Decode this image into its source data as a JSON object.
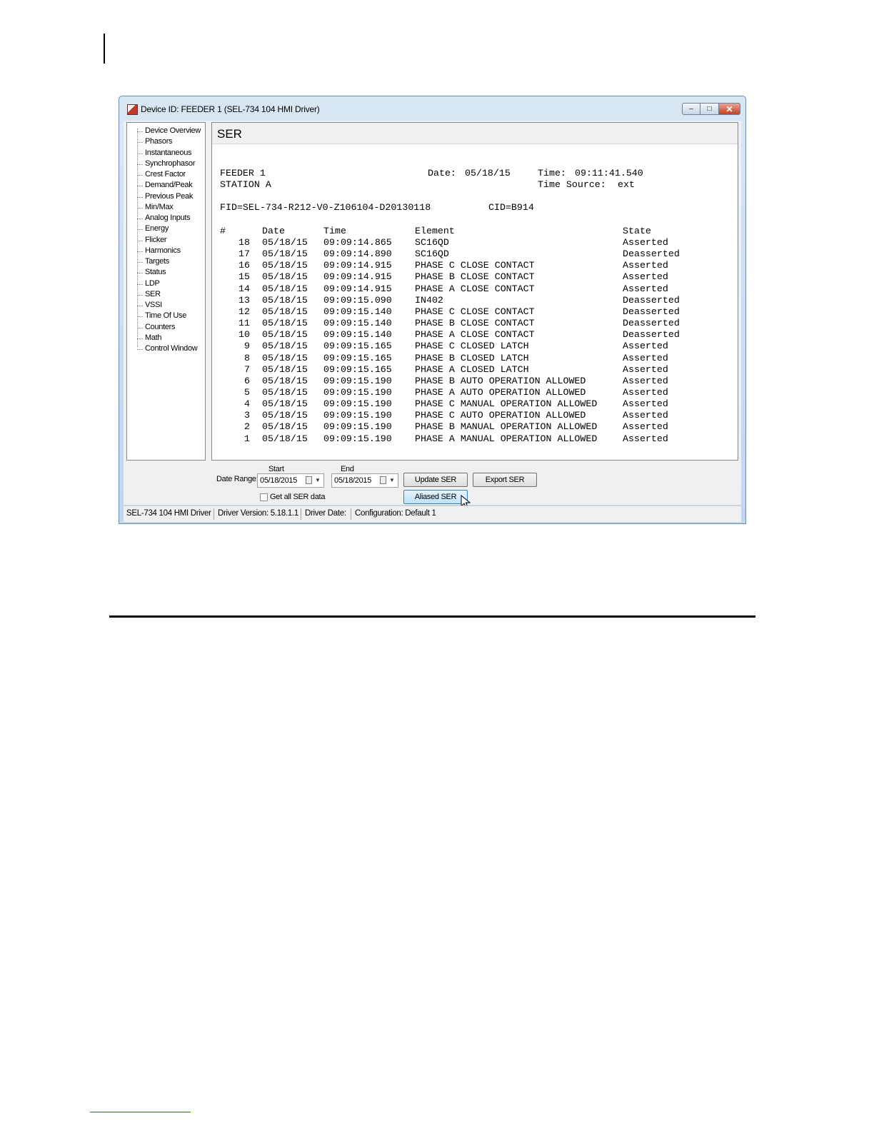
{
  "window": {
    "title": "Device ID: FEEDER 1 (SEL-734 104 HMI Driver)",
    "minimize_glyph": "–",
    "maximize_glyph": "□",
    "close_glyph": "✕"
  },
  "tree": {
    "items": [
      "Device Overview",
      "Phasors",
      "Instantaneous",
      "Synchrophasor",
      "Crest Factor",
      "Demand/Peak",
      "Previous Peak",
      "Min/Max",
      "Analog Inputs",
      "Energy",
      "Flicker",
      "Harmonics",
      "Targets",
      "Status",
      "LDP",
      "SER",
      "VSSI",
      "Time Of Use",
      "Counters",
      "Math",
      "Control Window"
    ],
    "selected": "SER"
  },
  "panel": {
    "title": "SER"
  },
  "report": {
    "device": "FEEDER 1",
    "station": "STATION A",
    "date_label": "Date:",
    "date": "05/18/15",
    "time_label": "Time:",
    "time": "09:11:41.540",
    "time_source_label": "Time Source:",
    "time_source": "ext",
    "fid": "FID=SEL-734-R212-V0-Z106104-D20130118",
    "cid": "CID=B914",
    "columns": {
      "num": "#",
      "date": "Date",
      "time": "Time",
      "element": "Element",
      "state": "State"
    },
    "rows": [
      {
        "num": "18",
        "date": "05/18/15",
        "time": "09:09:14.865",
        "element": "SC16QD",
        "state": "Asserted"
      },
      {
        "num": "17",
        "date": "05/18/15",
        "time": "09:09:14.890",
        "element": "SC16QD",
        "state": "Deasserted"
      },
      {
        "num": "16",
        "date": "05/18/15",
        "time": "09:09:14.915",
        "element": "PHASE C CLOSE CONTACT",
        "state": "Asserted"
      },
      {
        "num": "15",
        "date": "05/18/15",
        "time": "09:09:14.915",
        "element": "PHASE B CLOSE CONTACT",
        "state": "Asserted"
      },
      {
        "num": "14",
        "date": "05/18/15",
        "time": "09:09:14.915",
        "element": "PHASE A CLOSE CONTACT",
        "state": "Asserted"
      },
      {
        "num": "13",
        "date": "05/18/15",
        "time": "09:09:15.090",
        "element": "IN402",
        "state": "Deasserted"
      },
      {
        "num": "12",
        "date": "05/18/15",
        "time": "09:09:15.140",
        "element": "PHASE C CLOSE CONTACT",
        "state": "Deasserted"
      },
      {
        "num": "11",
        "date": "05/18/15",
        "time": "09:09:15.140",
        "element": "PHASE B CLOSE CONTACT",
        "state": "Deasserted"
      },
      {
        "num": "10",
        "date": "05/18/15",
        "time": "09:09:15.140",
        "element": "PHASE A CLOSE CONTACT",
        "state": "Deasserted"
      },
      {
        "num": "9",
        "date": "05/18/15",
        "time": "09:09:15.165",
        "element": "PHASE C CLOSED LATCH",
        "state": "Asserted"
      },
      {
        "num": "8",
        "date": "05/18/15",
        "time": "09:09:15.165",
        "element": "PHASE B CLOSED LATCH",
        "state": "Asserted"
      },
      {
        "num": "7",
        "date": "05/18/15",
        "time": "09:09:15.165",
        "element": "PHASE A CLOSED LATCH",
        "state": "Asserted"
      },
      {
        "num": "6",
        "date": "05/18/15",
        "time": "09:09:15.190",
        "element": "PHASE B AUTO OPERATION ALLOWED",
        "state": "Asserted"
      },
      {
        "num": "5",
        "date": "05/18/15",
        "time": "09:09:15.190",
        "element": "PHASE A AUTO OPERATION ALLOWED",
        "state": "Asserted"
      },
      {
        "num": "4",
        "date": "05/18/15",
        "time": "09:09:15.190",
        "element": "PHASE C MANUAL OPERATION ALLOWED",
        "state": "Asserted"
      },
      {
        "num": "3",
        "date": "05/18/15",
        "time": "09:09:15.190",
        "element": "PHASE C AUTO OPERATION ALLOWED",
        "state": "Asserted"
      },
      {
        "num": "2",
        "date": "05/18/15",
        "time": "09:09:15.190",
        "element": "PHASE B MANUAL OPERATION ALLOWED",
        "state": "Asserted"
      },
      {
        "num": "1",
        "date": "05/18/15",
        "time": "09:09:15.190",
        "element": "PHASE A MANUAL OPERATION ALLOWED",
        "state": "Asserted"
      }
    ]
  },
  "controls": {
    "date_range_label": "Date Range:",
    "start_label": "Start",
    "end_label": "End",
    "start_value": "05/18/2015",
    "end_value": "05/18/2015",
    "update_button": "Update SER",
    "export_button": "Export SER",
    "aliased_button": "Aliased SER",
    "get_all_label": "Get all SER data",
    "get_all_checked": false
  },
  "statusbar": {
    "driver": "SEL-734 104 HMI Driver",
    "version": "Driver Version: 5.18.1.1",
    "driver_date": "Driver Date:",
    "configuration": "Configuration: Default 1"
  }
}
